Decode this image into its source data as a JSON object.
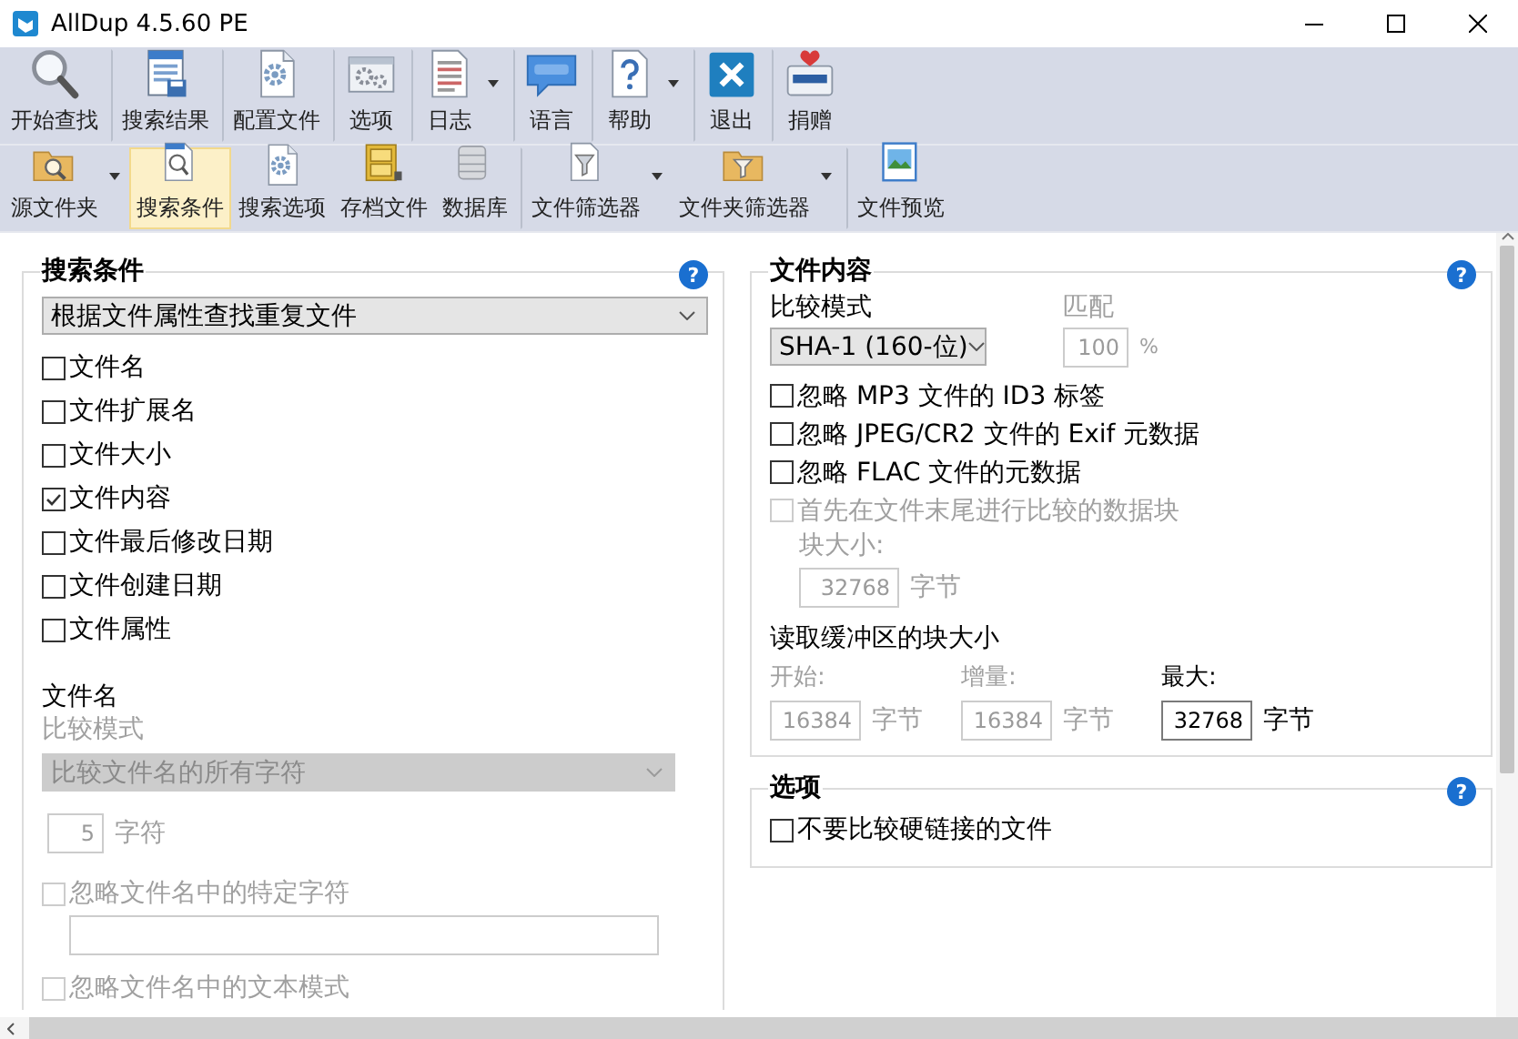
{
  "window": {
    "title": "AllDup 4.5.60 PE"
  },
  "main_toolbar": [
    {
      "label": "开始查找",
      "dropdown": false,
      "separator": false
    },
    {
      "label": "搜索结果",
      "dropdown": false,
      "separator": true
    },
    {
      "label": "配置文件",
      "dropdown": false,
      "separator": true
    },
    {
      "label": "选项",
      "dropdown": false,
      "separator": true
    },
    {
      "label": "日志",
      "dropdown": true,
      "separator": true
    },
    {
      "label": "语言",
      "dropdown": false,
      "separator": true
    },
    {
      "label": "帮助",
      "dropdown": true,
      "separator": true
    },
    {
      "label": "退出",
      "dropdown": false,
      "separator": true
    },
    {
      "label": "捐赠",
      "dropdown": false,
      "separator": true
    }
  ],
  "secondary_toolbar": [
    {
      "label": "源文件夹",
      "dropdown": true,
      "separator": false,
      "selected": false
    },
    {
      "label": "搜索条件",
      "dropdown": false,
      "separator": false,
      "selected": true
    },
    {
      "label": "搜索选项",
      "dropdown": false,
      "separator": false,
      "selected": false
    },
    {
      "label": "存档文件",
      "dropdown": false,
      "separator": false,
      "selected": false
    },
    {
      "label": "数据库",
      "dropdown": false,
      "separator": false,
      "selected": false
    },
    {
      "label": "文件筛选器",
      "dropdown": true,
      "separator": true,
      "selected": false
    },
    {
      "label": "文件夹筛选器",
      "dropdown": true,
      "separator": false,
      "selected": false
    },
    {
      "label": "文件预览",
      "dropdown": false,
      "separator": true,
      "selected": false
    }
  ],
  "search_criteria": {
    "title": "搜索条件",
    "help": "?",
    "mode": "根据文件属性查找重复文件",
    "checkboxes": [
      {
        "label": "文件名",
        "checked": false
      },
      {
        "label": "文件扩展名",
        "checked": false
      },
      {
        "label": "文件大小",
        "checked": false
      },
      {
        "label": "文件内容",
        "checked": true
      },
      {
        "label": "文件最后修改日期",
        "checked": false
      },
      {
        "label": "文件创建日期",
        "checked": false
      },
      {
        "label": "文件属性",
        "checked": false
      }
    ],
    "filename": {
      "heading": "文件名",
      "compare_mode_label": "比较模式",
      "compare_mode": {
        "value": "比较文件名的所有字符",
        "disabled": true
      },
      "length": {
        "value": "5",
        "unit": "字符",
        "disabled": true
      },
      "options": [
        {
          "label": "忽略文件名中的特定字符",
          "checked": false,
          "disabled": true,
          "kind": "with-input"
        },
        {
          "label": "忽略文件名中的文本模式",
          "checked": false,
          "disabled": true,
          "kind": "plain"
        }
      ]
    }
  },
  "file_content": {
    "title": "文件内容",
    "help": "?",
    "compare_mode_label": "比较模式",
    "compare_mode": "SHA-1 (160-位)",
    "match_label": "匹配",
    "match": {
      "value": "100",
      "unit": "%",
      "disabled": true
    },
    "checkboxes": [
      {
        "label": "忽略 MP3 文件的 ID3 标签",
        "checked": false,
        "disabled": false
      },
      {
        "label": "忽略 JPEG/CR2 文件的 Exif 元数据",
        "checked": false,
        "disabled": false
      },
      {
        "label": "忽略 FLAC 文件的元数据",
        "checked": false,
        "disabled": false
      },
      {
        "label": "首先在文件末尾进行比较的数据块",
        "checked": false,
        "disabled": true
      }
    ],
    "block_size": {
      "label": "块大小:",
      "value": "32768",
      "unit": "字节",
      "disabled": true
    },
    "buffer_heading": "读取缓冲区的块大小",
    "buffer_fields": [
      {
        "label": "开始:",
        "value": "16384",
        "unit": "字节",
        "disabled": true
      },
      {
        "label": "增量:",
        "value": "16384",
        "unit": "字节",
        "disabled": true
      },
      {
        "label": "最大:",
        "value": "32768",
        "unit": "字节",
        "disabled": false
      }
    ]
  },
  "options": {
    "title": "选项",
    "help": "?",
    "checkboxes": [
      {
        "label": "不要比较硬链接的文件",
        "checked": false
      }
    ]
  }
}
